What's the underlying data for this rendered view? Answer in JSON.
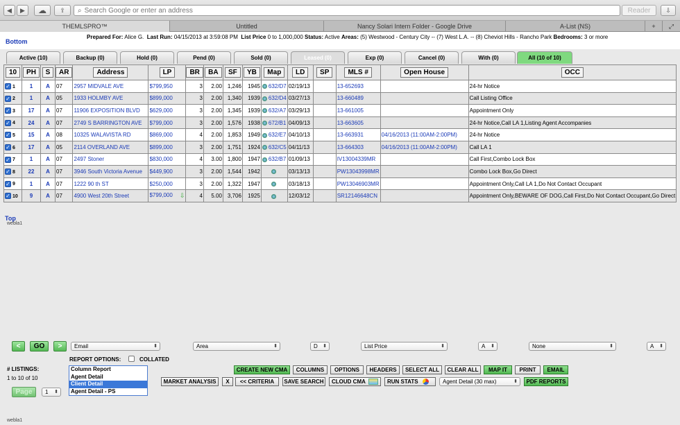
{
  "browser": {
    "address_placeholder": "Search Google or enter an address",
    "reader_label": "Reader",
    "tabs": [
      {
        "label": "THEMLSPRO™"
      },
      {
        "label": "Untitled"
      },
      {
        "label": "Nancy Solari Intern Folder - Google Drive"
      },
      {
        "label": "A-List (NS)"
      }
    ]
  },
  "header": {
    "bottom_link": "Bottom",
    "prepared_for_label": "Prepared For:",
    "prepared_for": "Alice G.",
    "last_run_label": "Last Run:",
    "last_run": "04/15/2013 at 3:59:08 PM",
    "list_price_label": "List Price",
    "list_price": "0 to 1,000,000",
    "status_label": "Status:",
    "status": "Active",
    "areas_label": "Areas:",
    "areas": "(5) Westwood - Century City -- (7) West L.A. -- (8) Cheviot Hills - Rancho Park",
    "bedrooms_label": "Bedrooms:",
    "bedrooms": "3 or more"
  },
  "status_tabs": [
    {
      "label": "Active (10)"
    },
    {
      "label": "Backup (0)"
    },
    {
      "label": "Hold (0)"
    },
    {
      "label": "Pend (0)"
    },
    {
      "label": "Sold (0)"
    },
    {
      "label": "Leased (0)"
    },
    {
      "label": "Exp (0)"
    },
    {
      "label": "Cancel (0)"
    },
    {
      "label": "With (0)"
    },
    {
      "label": "All (10 of 10)"
    }
  ],
  "columns": {
    "count": "10",
    "ph": "PH",
    "s": "S",
    "ar": "AR",
    "address": "Address",
    "lp": "LP",
    "br": "BR",
    "ba": "BA",
    "sf": "SF",
    "yb": "YB",
    "map": "Map",
    "ld": "LD",
    "sp": "SP",
    "mls": "MLS #",
    "open_house": "Open House",
    "occ": "OCC"
  },
  "rows": [
    {
      "n": "1",
      "ph": "1",
      "s": "A",
      "ar": "07",
      "address": "2957 MIDVALE AVE",
      "lp": "$799,950",
      "br": "3",
      "ba": "2.00",
      "sf": "1,246",
      "yb": "1945",
      "map": "632/D7",
      "ld": "02/19/13",
      "sp": "",
      "mls": "13-652693",
      "oh": "",
      "occ": "24-hr Notice"
    },
    {
      "n": "2",
      "ph": "1",
      "s": "A",
      "ar": "05",
      "address": "1933 HOLMBY AVE",
      "lp": "$899,000",
      "br": "3",
      "ba": "2.00",
      "sf": "1,340",
      "yb": "1939",
      "map": "632/D4",
      "ld": "03/27/13",
      "sp": "",
      "mls": "13-660489",
      "oh": "",
      "occ": "Call Listing Office"
    },
    {
      "n": "3",
      "ph": "17",
      "s": "A",
      "ar": "07",
      "address": "11906 EXPOSITION BLVD",
      "lp": "$629,000",
      "br": "3",
      "ba": "2.00",
      "sf": "1,345",
      "yb": "1939",
      "map": "632/A7",
      "ld": "03/29/13",
      "sp": "",
      "mls": "13-661005",
      "oh": "",
      "occ": "Appointment Only"
    },
    {
      "n": "4",
      "ph": "24",
      "s": "A",
      "ar": "07",
      "address": "2749 S BARRINGTON AVE",
      "lp": "$799,000",
      "br": "3",
      "ba": "2.00",
      "sf": "1,576",
      "yb": "1938",
      "map": "672/B1",
      "ld": "04/09/13",
      "sp": "",
      "mls": "13-663605",
      "oh": "",
      "occ": "24-hr Notice,Call LA 1,Listing Agent Accompanies"
    },
    {
      "n": "5",
      "ph": "15",
      "s": "A",
      "ar": "08",
      "address": "10325 WALAVISTA RD",
      "lp": "$869,000",
      "br": "4",
      "ba": "2.00",
      "sf": "1,853",
      "yb": "1949",
      "map": "632/E7",
      "ld": "04/10/13",
      "sp": "",
      "mls": "13-663931",
      "oh": "04/16/2013 (11:00AM-2:00PM)",
      "occ": "24-hr Notice"
    },
    {
      "n": "6",
      "ph": "17",
      "s": "A",
      "ar": "05",
      "address": "2114 OVERLAND AVE",
      "lp": "$899,000",
      "br": "3",
      "ba": "2.00",
      "sf": "1,751",
      "yb": "1924",
      "map": "632/C5",
      "ld": "04/11/13",
      "sp": "",
      "mls": "13-664303",
      "oh": "04/16/2013 (11:00AM-2:00PM)",
      "occ": "Call LA 1"
    },
    {
      "n": "7",
      "ph": "1",
      "s": "A",
      "ar": "07",
      "address": "2497 Stoner",
      "lp": "$830,000",
      "br": "4",
      "ba": "3.00",
      "sf": "1,800",
      "yb": "1947",
      "map": "632/B7",
      "ld": "01/09/13",
      "sp": "",
      "mls": "IV13004339MR",
      "oh": "",
      "occ": "Call First,Combo Lock Box"
    },
    {
      "n": "8",
      "ph": "22",
      "s": "A",
      "ar": "07",
      "address": "3946 South Victoria Avenue",
      "lp": "$449,900",
      "br": "3",
      "ba": "2.00",
      "sf": "1,544",
      "yb": "1942",
      "map": "",
      "ld": "03/13/13",
      "sp": "",
      "mls": "PW13043998MR",
      "oh": "",
      "occ": "Combo Lock Box,Go Direct"
    },
    {
      "n": "9",
      "ph": "1",
      "s": "A",
      "ar": "07",
      "address": "1222 90 th ST",
      "lp": "$250,000",
      "br": "3",
      "ba": "2.00",
      "sf": "1,322",
      "yb": "1947",
      "map": "",
      "ld": "03/18/13",
      "sp": "",
      "mls": "PW13046903MR",
      "oh": "",
      "occ": "Appointment Only,Call LA 1,Do Not Contact Occupant"
    },
    {
      "n": "10",
      "ph": "9",
      "s": "A",
      "ar": "07",
      "address": "4900 West 20th Street",
      "lp": "$799,000",
      "br": "4",
      "ba": "5.00",
      "sf": "3,706",
      "yb": "1925",
      "map": "",
      "ld": "12/03/12",
      "sp": "",
      "mls": "SR12146648CN",
      "oh": "",
      "occ": "Appointment Only,BEWARE OF DOG,Call First,Do Not Contact Occupant,Go Direct"
    }
  ],
  "footer": {
    "top_link": "Top",
    "webla": "webla1",
    "go_label": "GO",
    "prev_label": "<",
    "next_label": ">",
    "sort1": "Email",
    "sort2": "Area",
    "sort3": "D",
    "sort4": "List Price",
    "sort5": "A",
    "sort6": "None",
    "sort7": "A",
    "listings_label": "# LISTINGS:",
    "listings_range": "1 to 10 of 10",
    "page_label": "Page",
    "page_value": "1",
    "report_options_label": "REPORT OPTIONS:",
    "collated_label": "COLLATED",
    "report_list": [
      "Column Report",
      "Agent Detail",
      "Client Detail",
      "Agent Detail - PS"
    ],
    "buttons": {
      "market_analysis": "MARKET ANALYSIS",
      "x": "X",
      "criteria": "<< CRITERIA",
      "save_search": "SAVE SEARCH",
      "cloud_cma": "CLOUD CMA",
      "run_stats": "RUN STATS",
      "create_cma": "CREATE NEW CMA",
      "columns": "COLUMNS",
      "options": "OPTIONS",
      "headers": "HEADERS",
      "select_all": "SELECT ALL",
      "clear_all": "CLEAR ALL",
      "map_it": "MAP IT",
      "print": "PRINT",
      "email": "EMAIL",
      "pdf_reports": "PDF REPORTS"
    },
    "detail_select": "Agent Detail (30 max)"
  }
}
